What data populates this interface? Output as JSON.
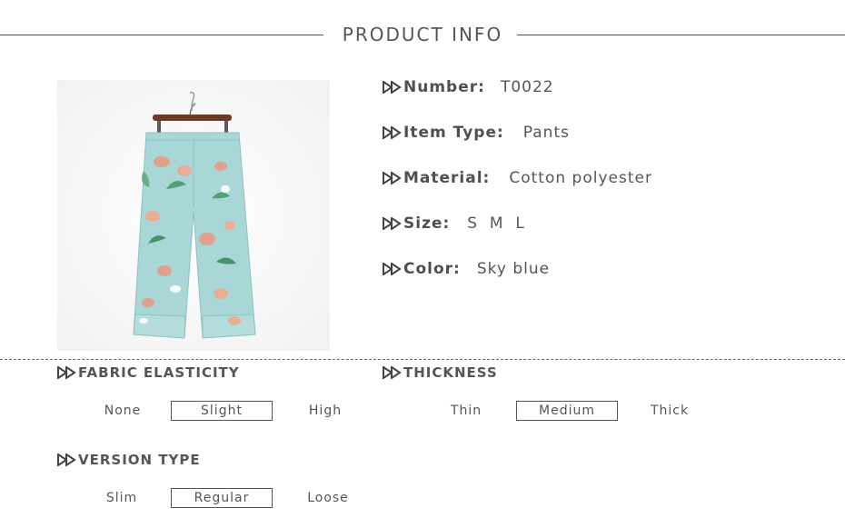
{
  "header": {
    "title": "PRODUCT INFO"
  },
  "product_image": {
    "alt": "Sky blue floral print wide-leg pants on a hanger"
  },
  "info": [
    {
      "label": "Number:",
      "value": "T0022"
    },
    {
      "label": "Item Type:",
      "value": "Pants"
    },
    {
      "label": "Material:",
      "value": "Cotton polyester"
    },
    {
      "label": "Size:",
      "value": "S  M  L"
    },
    {
      "label": "Color:",
      "value": "Sky blue"
    }
  ],
  "fabric_elasticity": {
    "title": "FABRIC ELASTICITY",
    "options": [
      "None",
      "Slight",
      "High"
    ],
    "selected": "Slight"
  },
  "thickness": {
    "title": "THICKNESS",
    "options": [
      "Thin",
      "Medium",
      "Thick"
    ],
    "selected": "Medium"
  },
  "version_type": {
    "title": "VERSION TYPE",
    "options": [
      "Slim",
      "Regular",
      "Loose"
    ],
    "selected": "Regular"
  },
  "colors": {
    "text": "#4a4a4a",
    "pants": "#a9d6d6",
    "hanger": "#6b3a2a"
  },
  "icons": {
    "bullet": "double-arrow-icon"
  }
}
